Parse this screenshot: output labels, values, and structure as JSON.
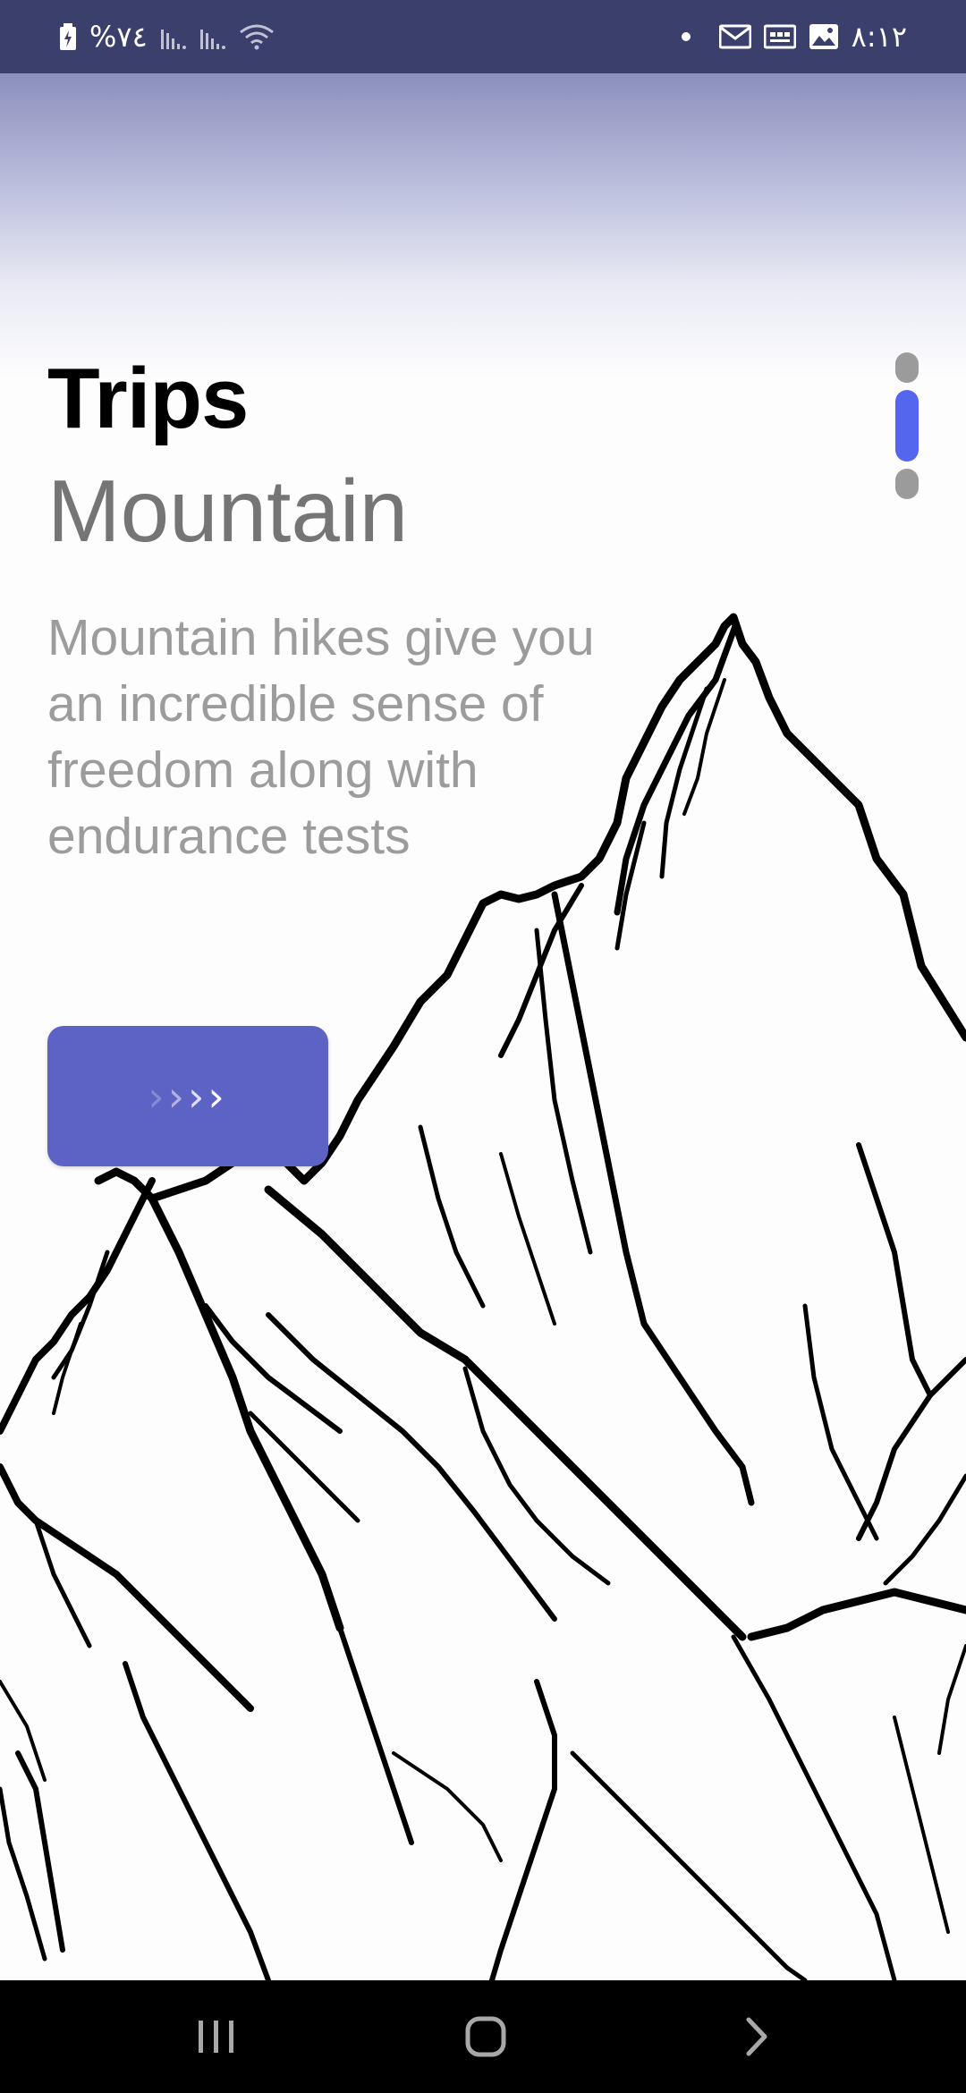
{
  "status_bar": {
    "battery_percent": "%٧٤",
    "time": "٨:١٢",
    "left_icons": [
      "battery-charging-icon",
      "signal-icon",
      "signal-icon",
      "wifi-icon"
    ],
    "right_icons": [
      "notification-dot-icon",
      "gmail-icon",
      "calendar-icon",
      "gallery-icon"
    ]
  },
  "main": {
    "title": "Trips",
    "subtitle": "Mountain",
    "description": "Mountain hikes give you an incredible sense of freedom along with endurance tests",
    "next_button_label": "››››",
    "next_button_icon": "chevrons-right-icon"
  },
  "page_indicator": {
    "total": 3,
    "active_index": 1
  },
  "colors": {
    "accent": "#5c63c4",
    "indicator_active": "#5566ee",
    "indicator_inactive": "#9b9b9b",
    "title": "#000000",
    "subtitle": "#757575",
    "description": "#9c9c9c",
    "status_bar": "#3b3f6c"
  },
  "nav_bar": {
    "items": [
      "recent-apps-icon",
      "home-icon",
      "back-icon"
    ]
  }
}
